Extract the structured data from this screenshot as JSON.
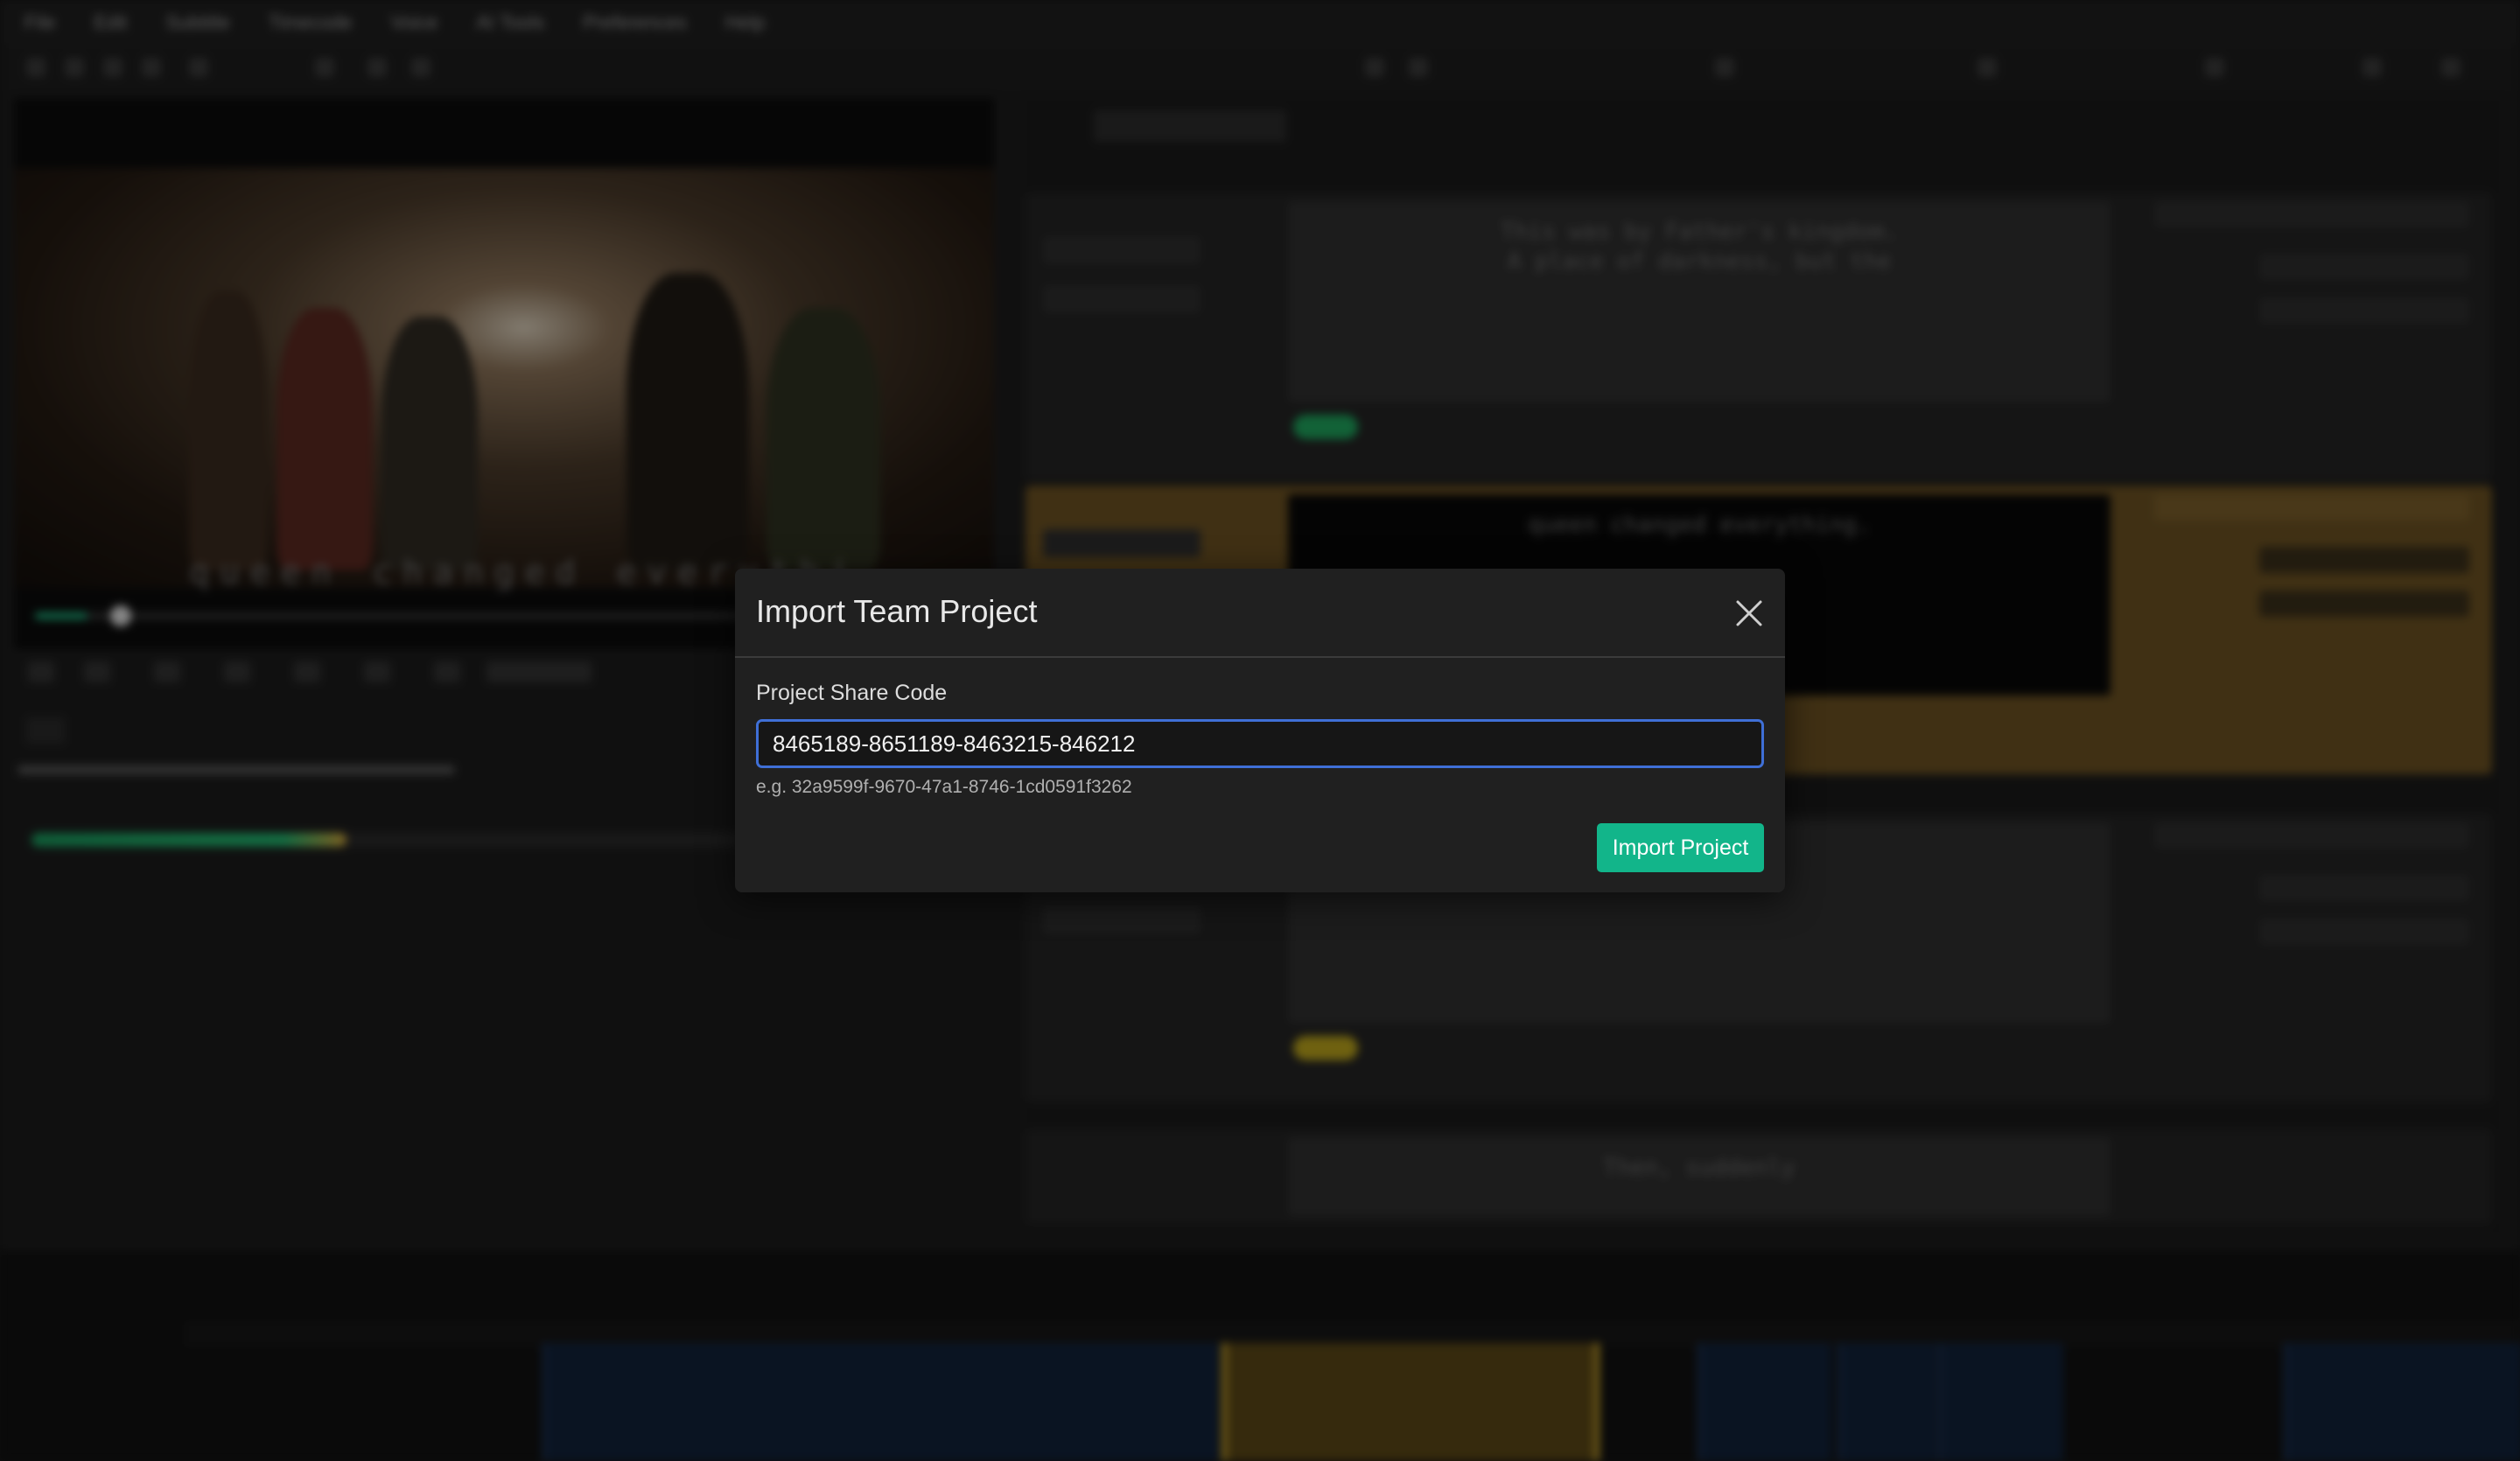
{
  "modal": {
    "title": "Import Team Project",
    "field_label": "Project Share Code",
    "input_value": "8465189-8651189-8463215-846212",
    "hint": "e.g. 32a9599f-9670-47a1-8746-1cd0591f3262",
    "import_label": "Import Project",
    "close_icon": "close-icon"
  },
  "background": {
    "menu": [
      "File",
      "Edit",
      "Subtitle",
      "Timecode",
      "Voice",
      "AI Tools",
      "Preferences",
      "Help"
    ],
    "subtitle_lines": [
      [
        "This was by Father's kingdom.",
        "A place of darkness, but the"
      ],
      [
        "queen changed everything."
      ],
      [
        ""
      ],
      [
        "Then, suddenly"
      ]
    ],
    "video_subtitle": "queen changed everythi"
  },
  "colors": {
    "accent_green": "#12b58a",
    "input_border": "#3f6fd6",
    "active_row": "#6b5122"
  }
}
